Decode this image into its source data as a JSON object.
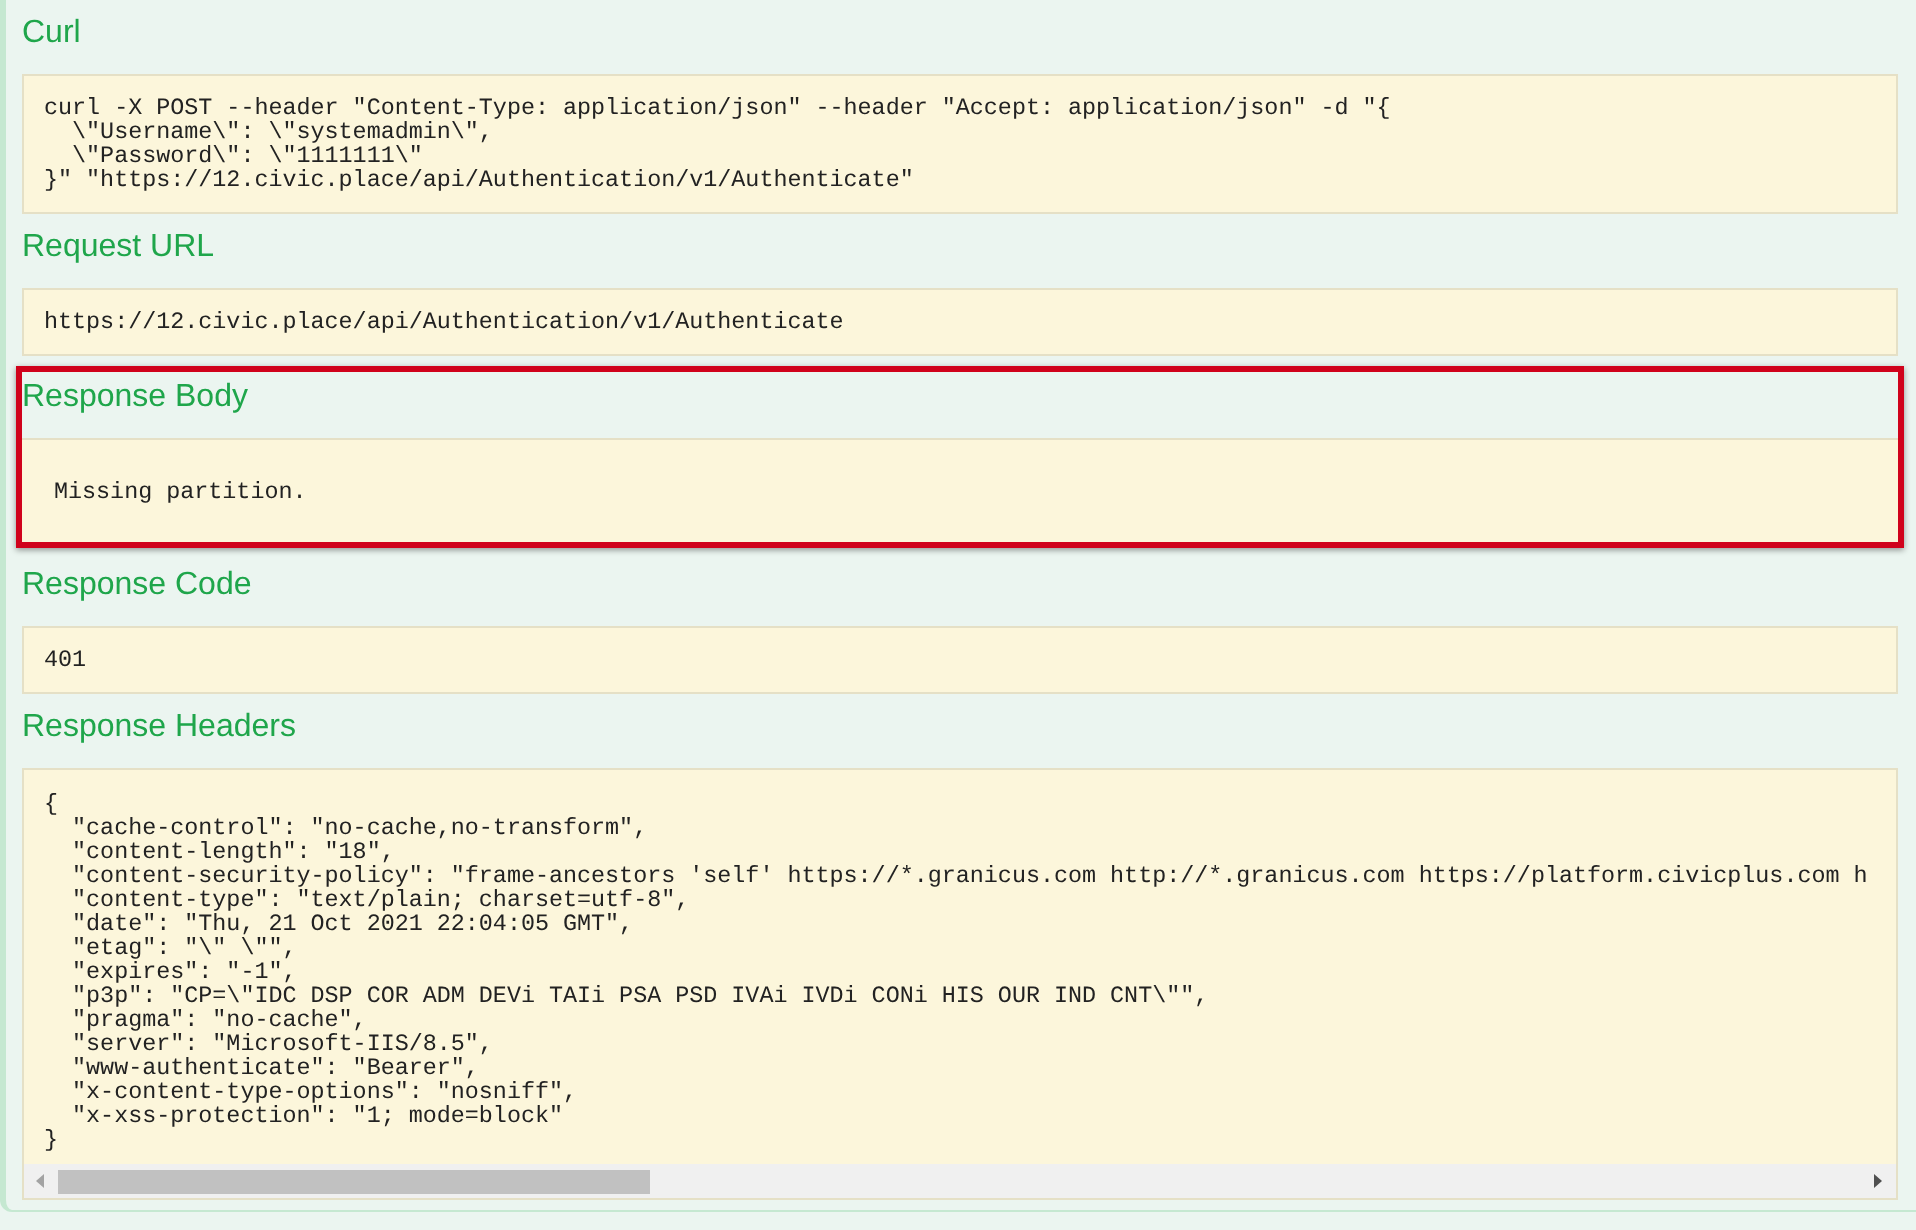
{
  "sections": [
    {
      "heading": "Curl",
      "highlighted": false,
      "kind": "code",
      "lines": [
        "curl -X POST --header \"Content-Type: application/json\" --header \"Accept: application/json\" -d \"{",
        "  \\\"Username\\\": \\\"systemadmin\\\",",
        "  \\\"Password\\\": \\\"1111111\\\"",
        "}\" \"https://12.civic.place/api/Authentication/v1/Authenticate\""
      ]
    },
    {
      "heading": "Request URL",
      "highlighted": false,
      "kind": "code",
      "lines": [
        "https://12.civic.place/api/Authentication/v1/Authenticate"
      ]
    },
    {
      "heading": "Response Body",
      "highlighted": true,
      "kind": "body",
      "lines": [
        "Missing partition."
      ]
    },
    {
      "heading": "Response Code",
      "highlighted": false,
      "kind": "code",
      "lines": [
        "401"
      ]
    },
    {
      "heading": "Response Headers",
      "highlighted": false,
      "kind": "scroll",
      "lines": [
        "{",
        "  \"cache-control\": \"no-cache,no-transform\",",
        "  \"content-length\": \"18\",",
        "  \"content-security-policy\": \"frame-ancestors 'self' https://*.granicus.com http://*.granicus.com https://platform.civicplus.com h",
        "  \"content-type\": \"text/plain; charset=utf-8\",",
        "  \"date\": \"Thu, 21 Oct 2021 22:04:05 GMT\",",
        "  \"etag\": \"\\\" \\\"\",",
        "  \"expires\": \"-1\",",
        "  \"p3p\": \"CP=\\\"IDC DSP COR ADM DEVi TAIi PSA PSD IVAi IVDi CONi HIS OUR IND CNT\\\"\",",
        "  \"pragma\": \"no-cache\",",
        "  \"server\": \"Microsoft-IIS/8.5\",",
        "  \"www-authenticate\": \"Bearer\",",
        "  \"x-content-type-options\": \"nosniff\",",
        "  \"x-xss-protection\": \"1; mode=block\"",
        "}"
      ]
    }
  ]
}
